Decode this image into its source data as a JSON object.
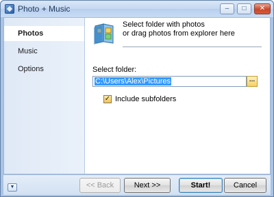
{
  "window": {
    "title": "Photo + Music",
    "minimize_glyph": "–",
    "maximize_glyph": "□",
    "close_glyph": "✕"
  },
  "sidebar": {
    "items": [
      {
        "label": "Photos",
        "active": true
      },
      {
        "label": "Music",
        "active": false
      },
      {
        "label": "Options",
        "active": false
      }
    ]
  },
  "main": {
    "header_line1": "Select folder with photos",
    "header_line2": "or drag photos from explorer here",
    "folder_label": "Select folder:",
    "folder_value": "C:\\Users\\Alex\\Pictures",
    "browse_label": "...",
    "include_subfolders_label": "Include subfolders",
    "include_subfolders_checked": true
  },
  "footer": {
    "menu_glyph": "▼",
    "back_label": "<< Back",
    "next_label": "Next >>",
    "start_label": "Start!",
    "cancel_label": "Cancel"
  },
  "colors": {
    "accent": "#3399ff",
    "sidebar_bg": "#dfe9f6",
    "titlebar": "#c4d8f1"
  }
}
